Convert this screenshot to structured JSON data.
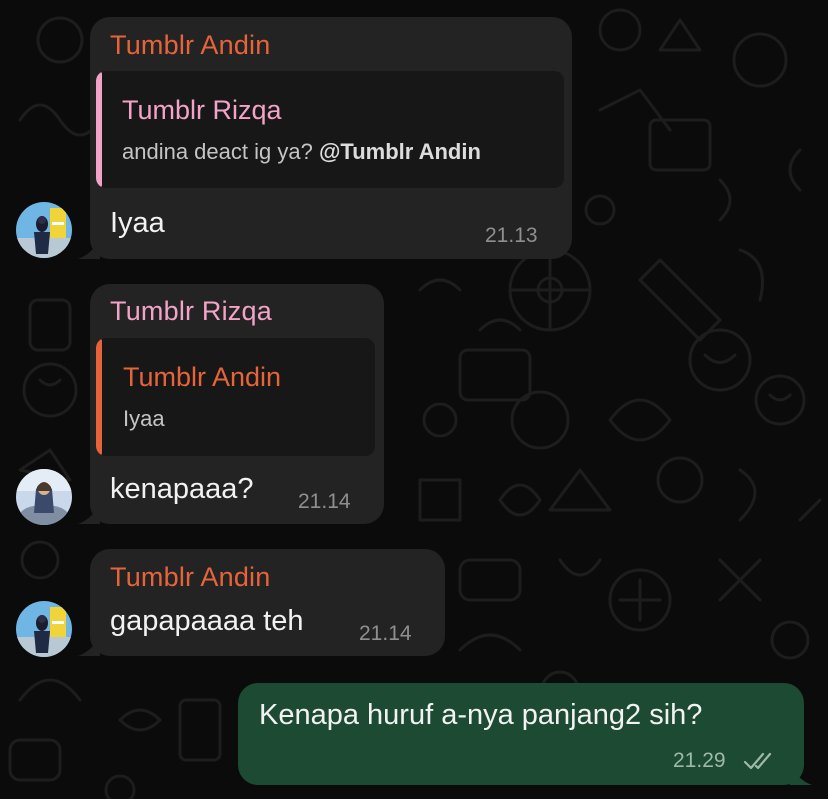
{
  "colors": {
    "background": "#0b0b0b",
    "incoming_bubble": "#232323",
    "outgoing_bubble": "#1d4a33",
    "quote_background": "#171717",
    "sender_andin": "#e7643a",
    "sender_rizqa": "#f3a3c8",
    "body_text": "#f2f2f2",
    "timestamp": "#8f8f8f"
  },
  "messages": [
    {
      "sender": "Tumblr Andin",
      "reply_to": {
        "sender": "Tumblr Rizqa",
        "text_prefix": "andina deact ig ya? ",
        "mention": "@Tumblr Andin"
      },
      "text": "Iyaa",
      "time": "21.13",
      "avatar_icon": "avatar-andin-icon"
    },
    {
      "sender": "Tumblr Rizqa",
      "reply_to": {
        "sender": "Tumblr Andin",
        "text": "Iyaa"
      },
      "text": "kenapaaa?",
      "time": "21.14",
      "avatar_icon": "avatar-rizqa-icon"
    },
    {
      "sender": "Tumblr Andin",
      "text": "gapapaaaa teh",
      "time": "21.14",
      "avatar_icon": "avatar-andin-icon"
    },
    {
      "text": "Kenapa huruf a-nya panjang2 sih?",
      "time": "21.29",
      "status_icon": "double-check-icon"
    }
  ]
}
